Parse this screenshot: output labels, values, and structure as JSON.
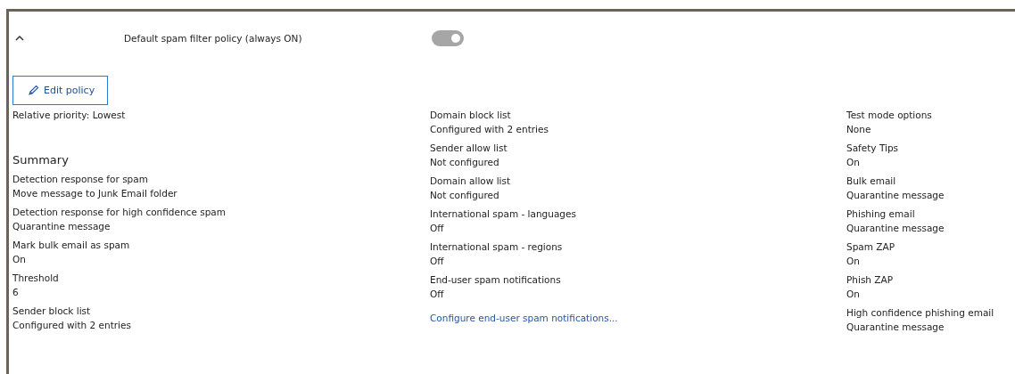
{
  "header": {
    "expanded": true,
    "title": "Default spam filter policy (always ON)",
    "toggle": {
      "on": true,
      "disabled": true
    }
  },
  "edit_button": {
    "label": "Edit policy"
  },
  "columns": [
    {
      "entries": [
        {
          "kind": "text",
          "text": "Relative priority: Lowest"
        },
        {
          "kind": "heading",
          "text": "Summary"
        },
        {
          "kind": "field",
          "label": "Detection response for spam",
          "value": "Move message to Junk Email folder"
        },
        {
          "kind": "field",
          "label": "Detection response for high confidence spam",
          "value": "Quarantine message"
        },
        {
          "kind": "field",
          "label": "Mark bulk email as spam",
          "value": "On"
        },
        {
          "kind": "field",
          "label": "Threshold",
          "value": "6"
        },
        {
          "kind": "field",
          "label": "Sender block list",
          "value": "Configured with 2 entries"
        }
      ]
    },
    {
      "entries": [
        {
          "kind": "field",
          "label": "Domain block list",
          "value": "Configured with 2 entries"
        },
        {
          "kind": "field",
          "label": "Sender allow list",
          "value": "Not configured"
        },
        {
          "kind": "field",
          "label": "Domain allow list",
          "value": "Not configured"
        },
        {
          "kind": "field",
          "label": "International spam - languages",
          "value": "Off"
        },
        {
          "kind": "field",
          "label": "International spam - regions",
          "value": "Off"
        },
        {
          "kind": "field",
          "label": "End-user spam notifications",
          "value": "Off"
        },
        {
          "kind": "link",
          "text": "Configure end-user spam notifications..."
        }
      ]
    },
    {
      "entries": [
        {
          "kind": "field",
          "label": "Test mode options",
          "value": "None"
        },
        {
          "kind": "field",
          "label": "Safety Tips",
          "value": "On"
        },
        {
          "kind": "field",
          "label": "Bulk email",
          "value": "Quarantine message"
        },
        {
          "kind": "field",
          "label": "Phishing email",
          "value": "Quarantine message"
        },
        {
          "kind": "field",
          "label": "Spam ZAP",
          "value": "On"
        },
        {
          "kind": "field",
          "label": "Phish ZAP",
          "value": "On"
        },
        {
          "kind": "field",
          "label": "High confidence phishing email",
          "value": "Quarantine message"
        }
      ]
    }
  ]
}
